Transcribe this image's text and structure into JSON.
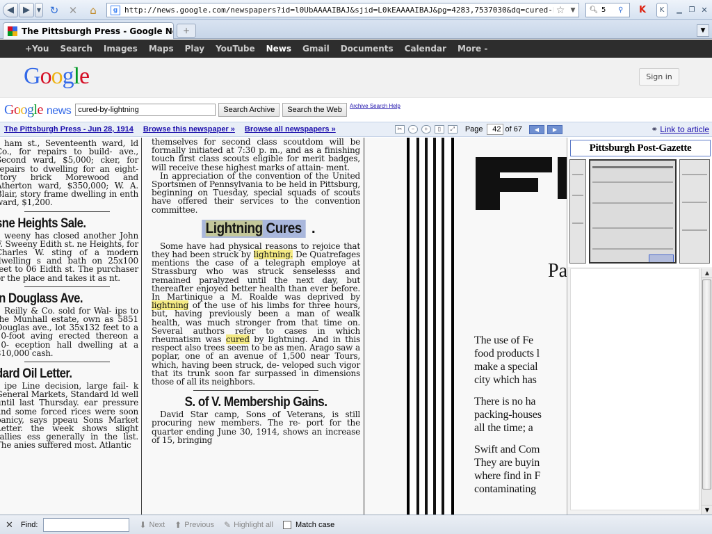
{
  "browser": {
    "url": "http://news.google.com/newspapers?id=l0UbAAAAIBAJ&sjid=L0kEAAAAIBAJ&pg=4283,7537030&dq=cured-by-lightning&hl=",
    "search_value": "5",
    "tab_title": "The Pittsburgh Press - Google News ..."
  },
  "gbar": {
    "items": [
      "+You",
      "Search",
      "Images",
      "Maps",
      "Play",
      "YouTube",
      "News",
      "Gmail",
      "Documents",
      "Calendar",
      "More -"
    ]
  },
  "header": {
    "logo_letters": [
      "G",
      "o",
      "o",
      "g",
      "l",
      "e"
    ],
    "sign_in": "Sign in"
  },
  "newsbar": {
    "logo_word": "Google",
    "logo_news": "news",
    "query": "cured-by-lightning",
    "search_archive": "Search Archive",
    "search_web": "Search the Web",
    "help": "Archive Search Help"
  },
  "viewbar": {
    "paper_link": "The Pittsburgh Press - Jun 28, 1914",
    "browse_paper": "Browse this newspaper »",
    "browse_all": "Browse all newspapers »",
    "page_label": "Page",
    "page_value": "42",
    "of_pages": "of 67",
    "link_to_article": "Link to article"
  },
  "article": {
    "col1": {
      "p1": "ham st., Seventeenth ward, ld Co., for repairs to build- ave., Second ward, $5,000; cker, for repairs to dwelling for an eight-story brick Morewood and Atherton ward, $350,000; W. A. Blair, story frame dwelling in enth ward, $1,200.",
      "h1": "sne Heights Sale.",
      "p2": "weeny has closed another John F. Sweeny Edith st. ne Heights, for Charles W. sting of a modern dwelling s and bath on 25x100 feet to 06 Eidth st. The purchaser or the place and takes it as nt.",
      "h2": "in Douglass Ave.",
      "p3": "Reilly & Co. sold for Wal- ips to the Munhall estate, own as 5851 Douglas ave., lot 35x132 feet to a 10-foot aving erected thereon a 10- eception hall dwelling at a $10,000 cash.",
      "h3": "dard Oil Letter.",
      "p4": "ipe Line decision, large fail- k General Markets, Standard ld well until last Thursday. ear pressure and some forced rices were soon panicy, says ppeau Sons Market Letter. the week shows slight rallies ess generally in the list. The anies suffered most. Atlantic"
    },
    "col2": {
      "p0": "themselves for second class scoutdom will be formally initiated at 7:30 p. m., and as a finishing touch first class scouts eligible for merit badges, will receive these highest marks of attain- ment.",
      "p1": "In appreciation of the convention of the United Sportsmen of Pennsylvania to be held in Pittsburg, beginning on Tuesday, special squads of scouts have offered their services to the convention committee.",
      "head_word1": "Lightning",
      "head_word2": "Cures",
      "head_dot": ".",
      "p2_a": "Some have had physical reasons to rejoice that they had been struck by",
      "p2_hl1": "lightning.",
      "p2_b": "De Quatrefages mentions the case of a telegraph employe at Strassburg who was struck senselesss and remained paralyzed until the next day, but thereafter enjoyed better health than ever before. In Martinique a M. Roalde was deprived by",
      "p2_hl2": "lightning",
      "p2_c": "of the use of his limbs for three hours, but, having previously been a man of wealk health, was much stronger from that time on. Several authors refer to cases in which rheumatism was",
      "p2_hl3": "cured",
      "p2_d": "by lightning. And in this respect also trees seem to be as men. Arago saw a poplar, one of an avenue of 1,500 near Tours, which, having been struck, de- veloped such vigor that its trunk soon far surpassed in dimensions those of all its neighbors.",
      "h2": "S. of V. Membership Gains.",
      "p3": "David Star camp, Sons of Veterans, is still procuring new members. The re- port for the quarter ending June 30, 1914, shows an increase of 15, bringing"
    },
    "col3": {
      "pa": "Pa",
      "lines1": [
        "The use of Fe",
        "food products l",
        "make a special",
        "city which has"
      ],
      "lines2": [
        "There is no ha",
        "packing-houses",
        "all the time; a"
      ],
      "lines3": [
        "Swift and Com",
        "They are buyin",
        "where find in F",
        "contaminating"
      ]
    }
  },
  "thumbs": {
    "masthead": "Pittsburgh Post-Gazette"
  },
  "findbar": {
    "close": "✕",
    "label": "Find:",
    "value": "",
    "next": "Next",
    "previous": "Previous",
    "highlight": "Highlight all",
    "match_case": "Match case"
  }
}
